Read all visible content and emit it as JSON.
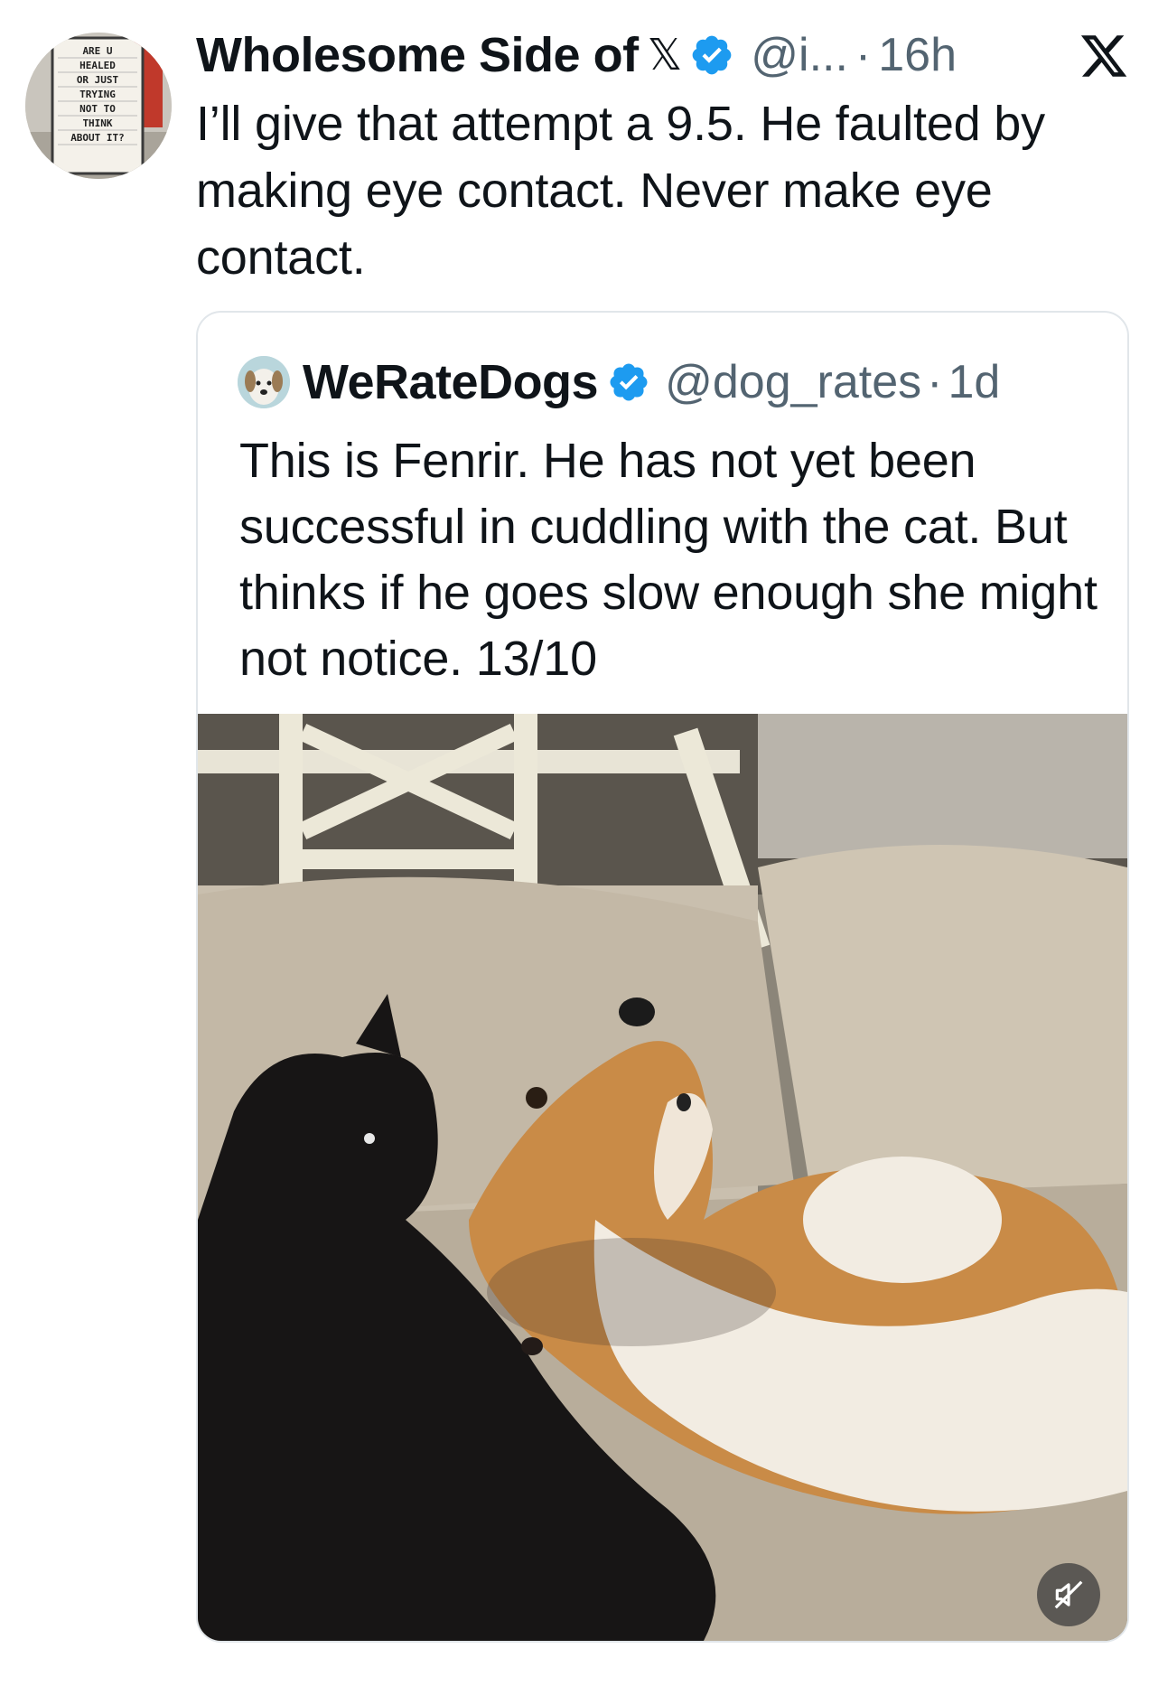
{
  "tweet": {
    "author_name": "Wholesome Side of",
    "author_badge": "𝕏",
    "handle": "@i...",
    "separator": "·",
    "time": "16h",
    "text": "I’ll give that attempt a 9.5. He faulted by making eye contact. Never make eye contact.",
    "avatar_sign_text": "ARE U HEALED OR JUST TRYING NOT TO THINK ABOUT IT?"
  },
  "quote": {
    "author_name": "WeRateDogs",
    "handle": "@dog_rates",
    "separator": "·",
    "time": "1d",
    "text": "This is Fenrir. He has not yet been successful in cuddling with the cat. But thinks if he goes slow enough she might not notice. 13/10"
  },
  "icons": {
    "verified": "verified-badge-icon",
    "close_logo": "x-logo-icon",
    "mute": "muted-speaker-icon"
  },
  "colors": {
    "verified_blue": "#1d9bf0",
    "secondary_text": "#536471",
    "card_border": "#e1e6ea"
  }
}
